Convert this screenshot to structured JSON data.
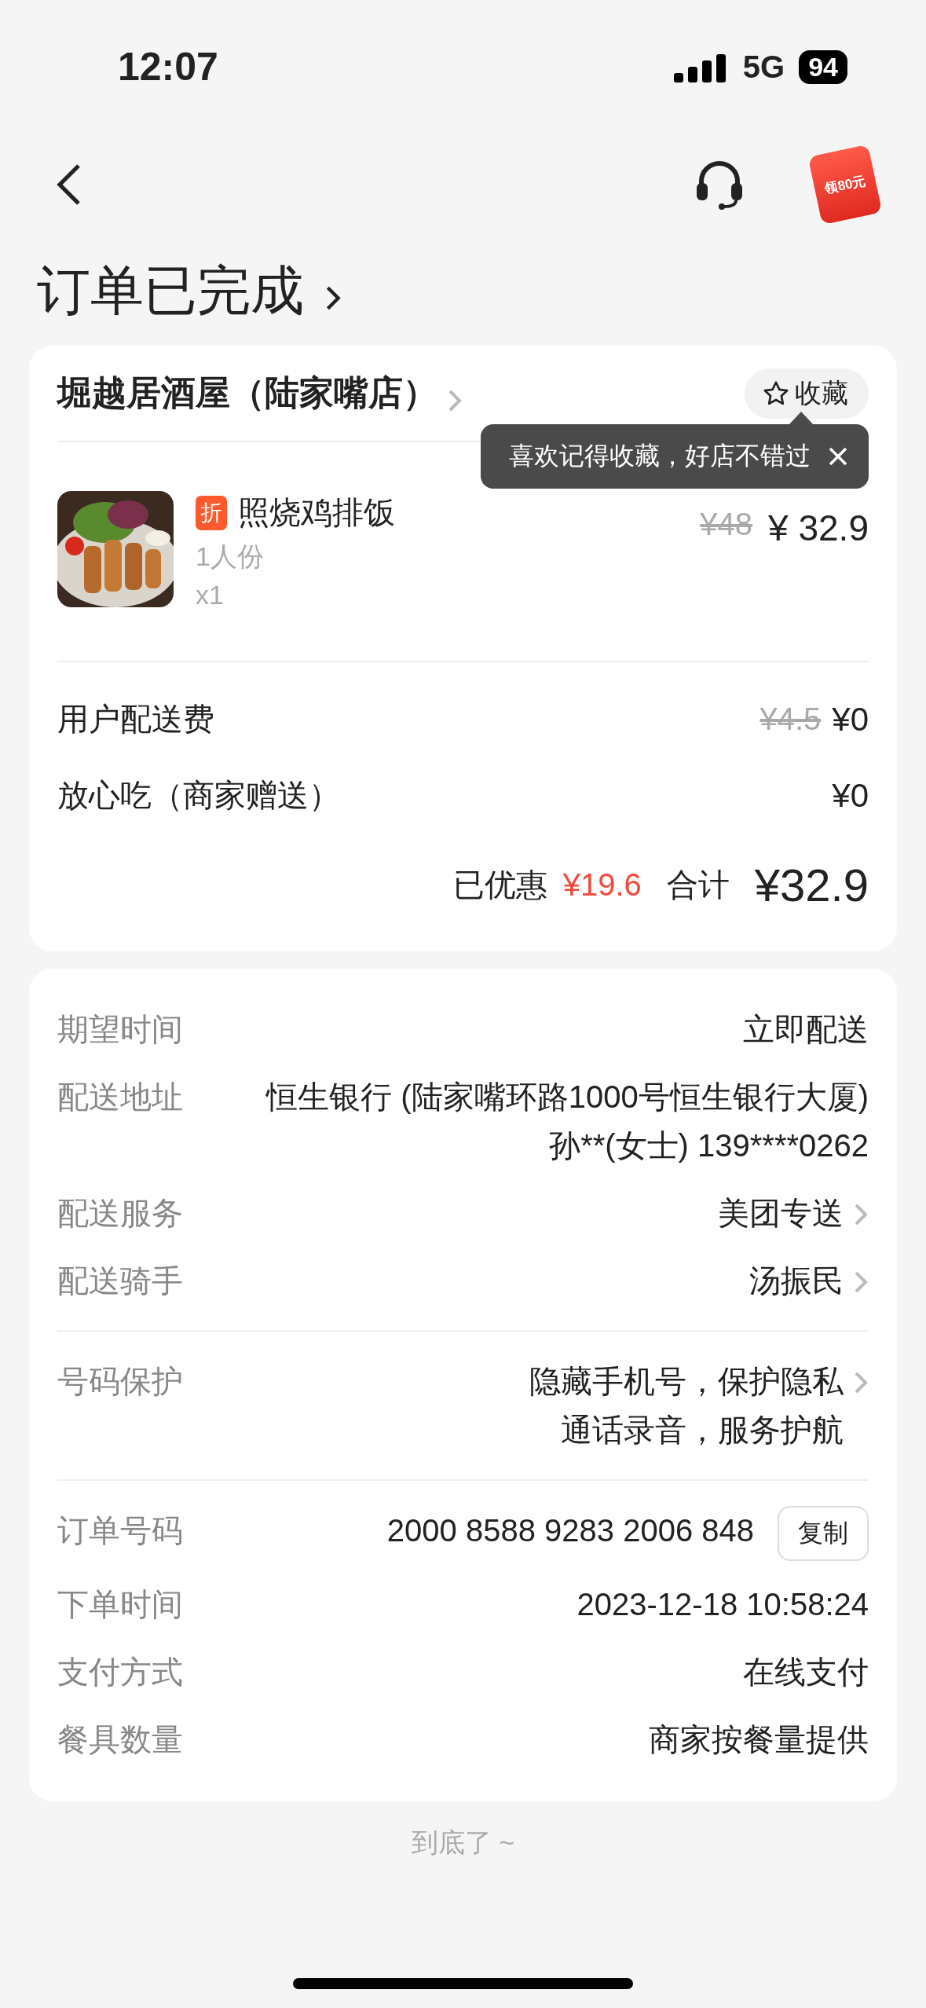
{
  "status_bar": {
    "time": "12:07",
    "network": "5G",
    "battery": "94"
  },
  "nav": {
    "promo": "领80元"
  },
  "title": "订单已完成",
  "shop": {
    "name": "堀越居酒屋（陆家嘴店）",
    "favorite": "收藏",
    "tooltip": "喜欢记得收藏，好店不错过"
  },
  "items": [
    {
      "tag": "折",
      "name": "照烧鸡排饭",
      "spec": "1人份",
      "qty": "x1",
      "original_price": "¥48",
      "price": "¥ 32.9"
    }
  ],
  "fees": [
    {
      "label": "用户配送费",
      "original": "¥4.5",
      "value": "¥0"
    },
    {
      "label": "放心吃（商家赠送）",
      "value": "¥0"
    }
  ],
  "summary": {
    "discount_label": "已优惠",
    "discount": "¥19.6",
    "total_label": "合计",
    "total": "¥32.9"
  },
  "details": [
    [
      {
        "kind": "text",
        "label": "期望时间",
        "lines": [
          "立即配送"
        ]
      },
      {
        "kind": "text",
        "label": "配送地址",
        "lines": [
          "恒生银行 (陆家嘴环路1000号恒生银行大厦)",
          "孙**(女士) 139****0262"
        ]
      },
      {
        "kind": "link",
        "label": "配送服务",
        "lines": [
          "美团专送"
        ]
      },
      {
        "kind": "link",
        "label": "配送骑手",
        "lines": [
          "汤振民"
        ]
      }
    ],
    [
      {
        "kind": "link",
        "label": "号码保护",
        "lines": [
          "隐藏手机号，保护隐私",
          "通话录音，服务护航"
        ]
      }
    ],
    [
      {
        "kind": "copy",
        "label": "订单号码",
        "lines": [
          "2000 8588 9283 2006 848"
        ],
        "action": "复制"
      },
      {
        "kind": "text",
        "label": "下单时间",
        "lines": [
          "2023-12-18 10:58:24"
        ]
      },
      {
        "kind": "text",
        "label": "支付方式",
        "lines": [
          "在线支付"
        ]
      },
      {
        "kind": "text",
        "label": "餐具数量",
        "lines": [
          "商家按餐量提供"
        ]
      }
    ]
  ],
  "footer": "到底了 ~"
}
